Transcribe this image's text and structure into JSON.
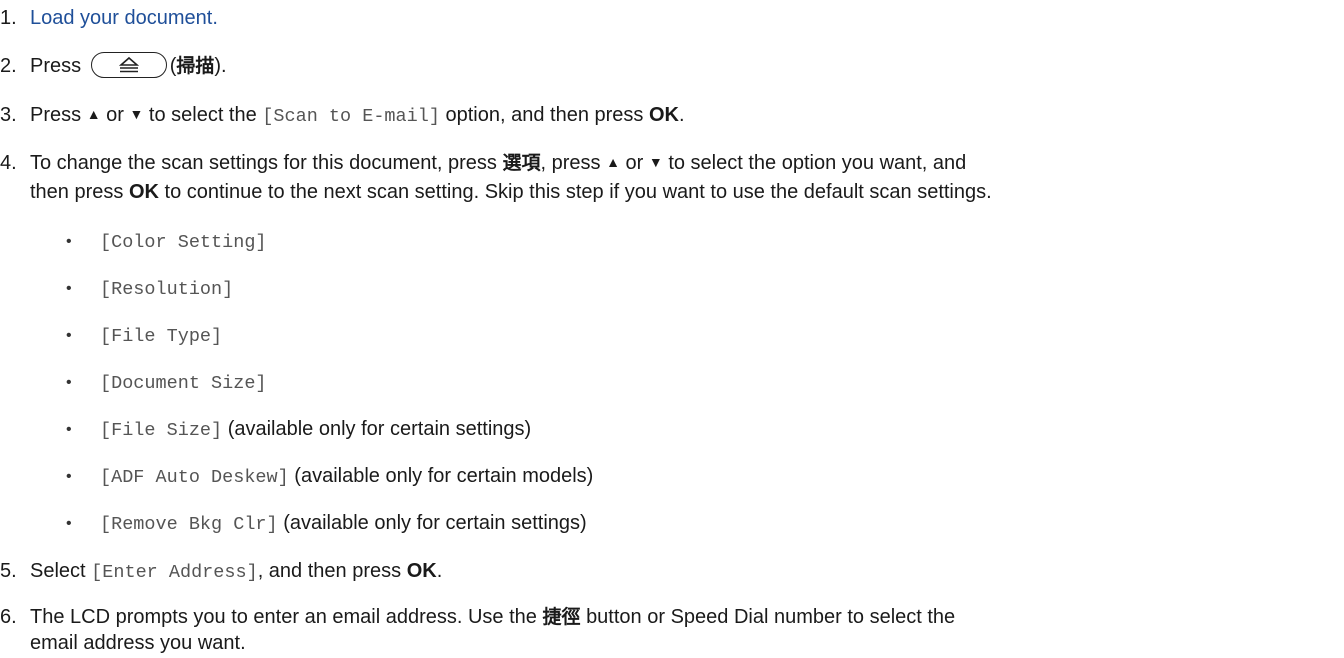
{
  "steps": {
    "s1": {
      "num": "1.",
      "text": "Load your document."
    },
    "s2": {
      "num": "2.",
      "press": "Press",
      "paren_open": "(",
      "label_cjk": "掃描",
      "paren_close": ").",
      "icon": "scan-button-icon"
    },
    "s3": {
      "num": "3.",
      "press": "Press",
      "up": "▲",
      "or": "or",
      "down": "▼",
      "to_select": "to select the",
      "option": "[Scan to E-mail]",
      "rest": "option, and then press",
      "ok": "OK",
      "end": "."
    },
    "s4": {
      "num": "4.",
      "line1_a": "To change the scan settings for this document, press",
      "options_cjk": "選項",
      "line1_b": ", press",
      "up": "▲",
      "or": "or",
      "down": "▼",
      "line1_c": "to select the option you want, and",
      "line2_a": "then press",
      "ok": "OK",
      "line2_b": "to continue to the next scan setting. Skip this step if you want to use the default scan settings.",
      "bullets": [
        {
          "code": "[Color Setting]",
          "note": ""
        },
        {
          "code": "[Resolution]",
          "note": ""
        },
        {
          "code": "[File Type]",
          "note": ""
        },
        {
          "code": "[Document Size]",
          "note": ""
        },
        {
          "code": "[File Size]",
          "note": "(available only for certain settings)"
        },
        {
          "code": "[ADF Auto Deskew]",
          "note": "(available only for certain models)"
        },
        {
          "code": "[Remove Bkg Clr]",
          "note": "(available only for certain settings)"
        }
      ],
      "bullet_char": "•"
    },
    "s5": {
      "num": "5.",
      "select": "Select",
      "code": "[Enter Address]",
      "rest": ", and then press",
      "ok": "OK",
      "end": "."
    },
    "s6": {
      "num": "6.",
      "line1_a": "The LCD prompts you to enter an email address. Use the",
      "shortcut_cjk": "捷徑",
      "line1_b": "button or Speed Dial number to select the",
      "line2": "email address you want."
    }
  },
  "colors": {
    "link": "#1f4f99",
    "code": "#555555",
    "text": "#1a1a1a"
  }
}
